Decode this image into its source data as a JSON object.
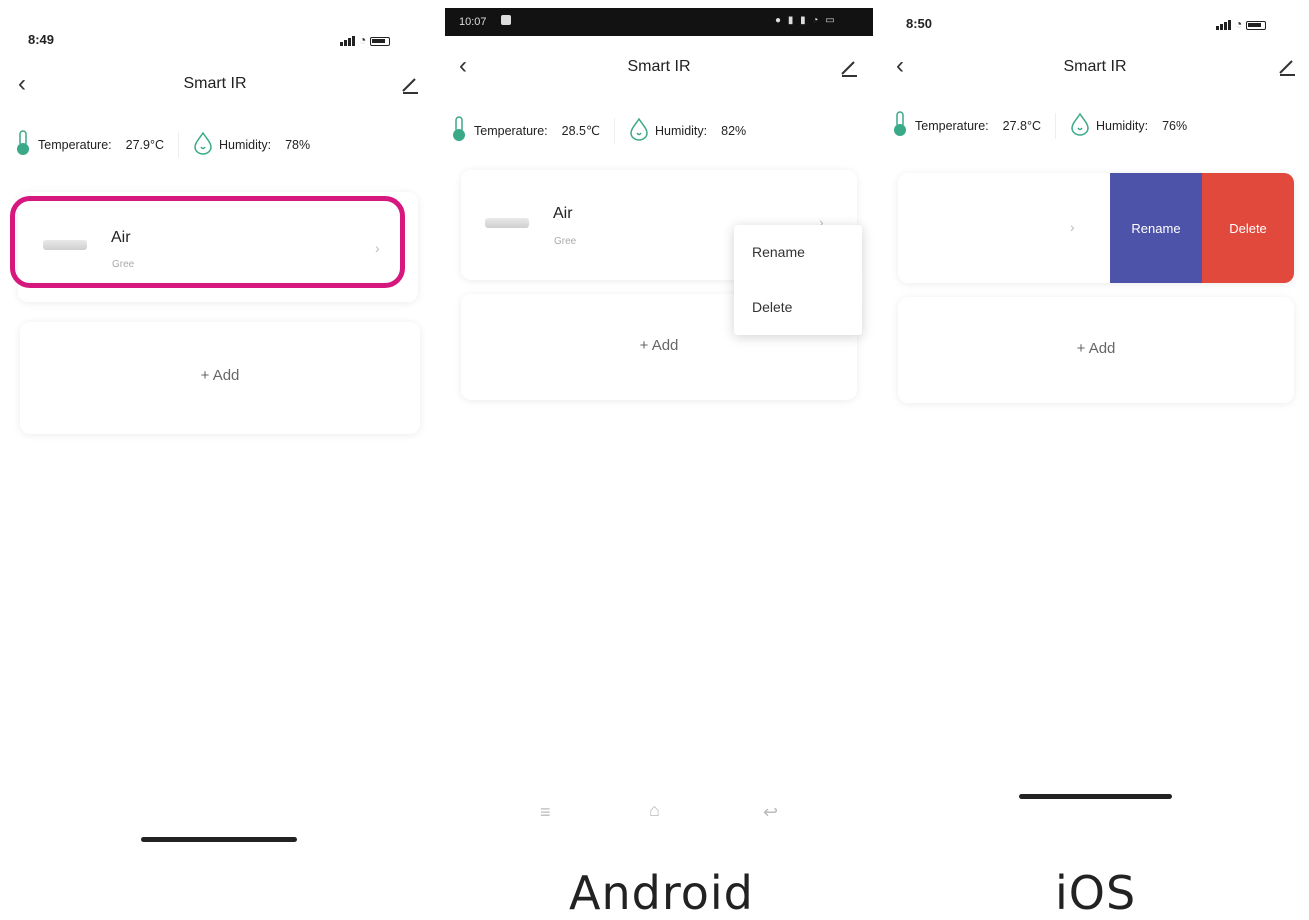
{
  "screens": [
    {
      "time": "8:49",
      "title": "Smart IR",
      "temperature_label": "Temperature:",
      "temperature_value": "27.9°C",
      "humidity_label": "Humidity:",
      "humidity_value": "78%",
      "device_name": "Air",
      "device_brand": "Gree",
      "add_label": "+ Add"
    },
    {
      "time": "10:07",
      "title": "Smart IR",
      "temperature_label": "Temperature:",
      "temperature_value": "28.5℃",
      "humidity_label": "Humidity:",
      "humidity_value": "82%",
      "device_name": "Air",
      "device_brand": "Gree",
      "add_label": "+ Add",
      "menu": [
        "Rename",
        "Delete"
      ],
      "caption": "Android"
    },
    {
      "time": "8:50",
      "title": "Smart IR",
      "temperature_label": "Temperature:",
      "temperature_value": "27.8°C",
      "humidity_label": "Humidity:",
      "humidity_value": "76%",
      "swipe_actions": [
        "Rename",
        "Delete"
      ],
      "add_label": "+ Add",
      "caption": "iOS"
    }
  ],
  "colors": {
    "accent_teal": "#3aa987",
    "highlight_pink": "#d6177d",
    "rename_blue": "#4c53a8",
    "delete_red": "#e0493b"
  },
  "icons": [
    "back-arrow-icon",
    "edit-pencil-icon",
    "thermometer-icon",
    "water-drop-icon",
    "air-conditioner-icon",
    "chevron-right-icon"
  ]
}
